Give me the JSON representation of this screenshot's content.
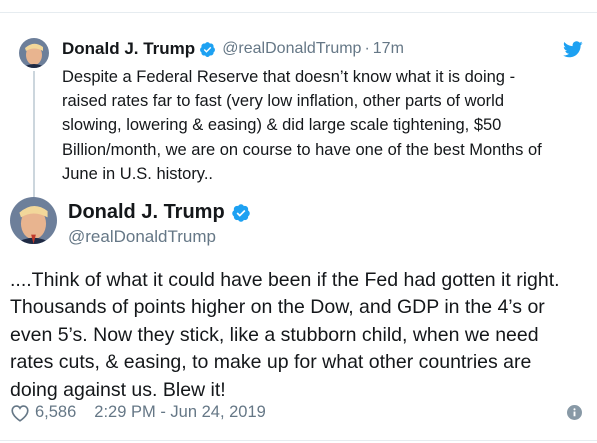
{
  "quoted_tweet": {
    "name": "Donald J. Trump",
    "handle": "@realDonaldTrump",
    "separator": "·",
    "time": "17m",
    "text_lines": [
      "Despite a Federal Reserve that doesn’t know what it is doing -",
      "raised rates far to fast (very low inflation, other parts of world",
      "slowing, lowering & easing) & did large scale tightening, $50",
      "Billion/month, we are on course to have one of the best Months of",
      "June in U.S. history.."
    ]
  },
  "main_tweet": {
    "name": "Donald J. Trump",
    "handle": "@realDonaldTrump",
    "text_lines": [
      "....Think of what it could have been if the Fed had gotten it right.",
      "Thousands of points higher on the Dow, and GDP in the 4’s or",
      "even 5’s. Now they stick, like a stubborn child, when we need",
      "rates cuts, & easing, to make up for what other countries are",
      "doing against us. Blew it!"
    ],
    "likes": "6,586",
    "timestamp": "2:29 PM - Jun 24, 2019"
  },
  "icons": {
    "verified": "verified-badge-icon",
    "bird": "twitter-bird-icon",
    "heart": "heart-icon",
    "info": "info-icon"
  },
  "colors": {
    "twitter_blue": "#1da1f2",
    "secondary_text": "#657786",
    "primary_text": "#14171a",
    "divider": "#e6ecf0"
  }
}
